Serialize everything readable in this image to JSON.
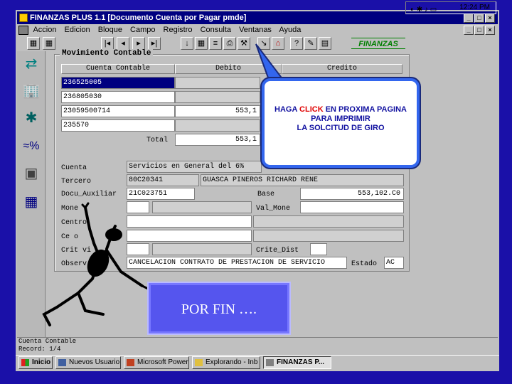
{
  "window": {
    "title": "FINANZAS PLUS 1.1   [Documento Cuenta por Pagar   pmde]",
    "controls": [
      "_",
      "□",
      "×"
    ],
    "doc_controls": [
      "_",
      "□",
      "×"
    ]
  },
  "menu": [
    "Accion",
    "Edicion",
    "Bloque",
    "Campo",
    "Registro",
    "Consulta",
    "Ventanas",
    "Ayuda"
  ],
  "toolbar": {
    "brand": "FINANZAS"
  },
  "group_title": "Movimiento Contable",
  "grid": {
    "headers": [
      "Cuenta Contable",
      "Debito",
      "Credito"
    ],
    "rows": [
      [
        "236525005",
        "",
        ""
      ],
      [
        "236805030",
        "",
        ""
      ],
      [
        "23059500714",
        "553,1",
        ""
      ],
      [
        "235570",
        "",
        ""
      ]
    ],
    "total_label": "Total",
    "total_value": "553,1"
  },
  "form": {
    "cuenta_label": "Cuenta",
    "cuenta_value": "Servicios en General del 6%",
    "tercero_label": "Tercero",
    "tercero_id": "80C20341",
    "tercero_name": "GUASCA PINEROS RICHARD RENE",
    "docu_label": "Docu_Auxiliar",
    "docu_value": "21C023751",
    "base_label": "Base",
    "base_value": "553,102.C0",
    "moneda_label": "Mone",
    "val_mone_label": "Val_Mone",
    "centro_label": "Centro",
    "ceco_label": "Ce   o",
    "crite_label": "Crit      vi",
    "crite_dist_label": "Crite_Dist",
    "observ_label": "Observ",
    "observ_value": "CANCELACION CONTRATO DE PRESTACION DE SERVICIO",
    "estado_label": "Estado",
    "estado_value": "AC"
  },
  "callout": {
    "line1_pre": "HAGA ",
    "line1_click": "CLICK",
    "line1_post": " EN PROXIMA PAGINA",
    "line2": "PARA IMPRIMIR",
    "line3": "LA SOLCITUD DE GIRO"
  },
  "porfin": "POR FIN ….",
  "statusbar": {
    "line1": "Cuenta Contable",
    "line2": "Record: 1/4"
  },
  "taskbar": {
    "start": "Inicio",
    "tasks": [
      "Nuevos Usuario",
      "Microsoft Power",
      "Explorando - Inb",
      "FINANZAS P..."
    ],
    "clock": "12:24 PM"
  },
  "colors": {
    "desktop": "#1a10a8",
    "titlebar": "#000080",
    "callout_border": "#3366ee",
    "callout_text": "#1010a0",
    "click": "#e00000",
    "porfin_bg": "#5555ee"
  }
}
